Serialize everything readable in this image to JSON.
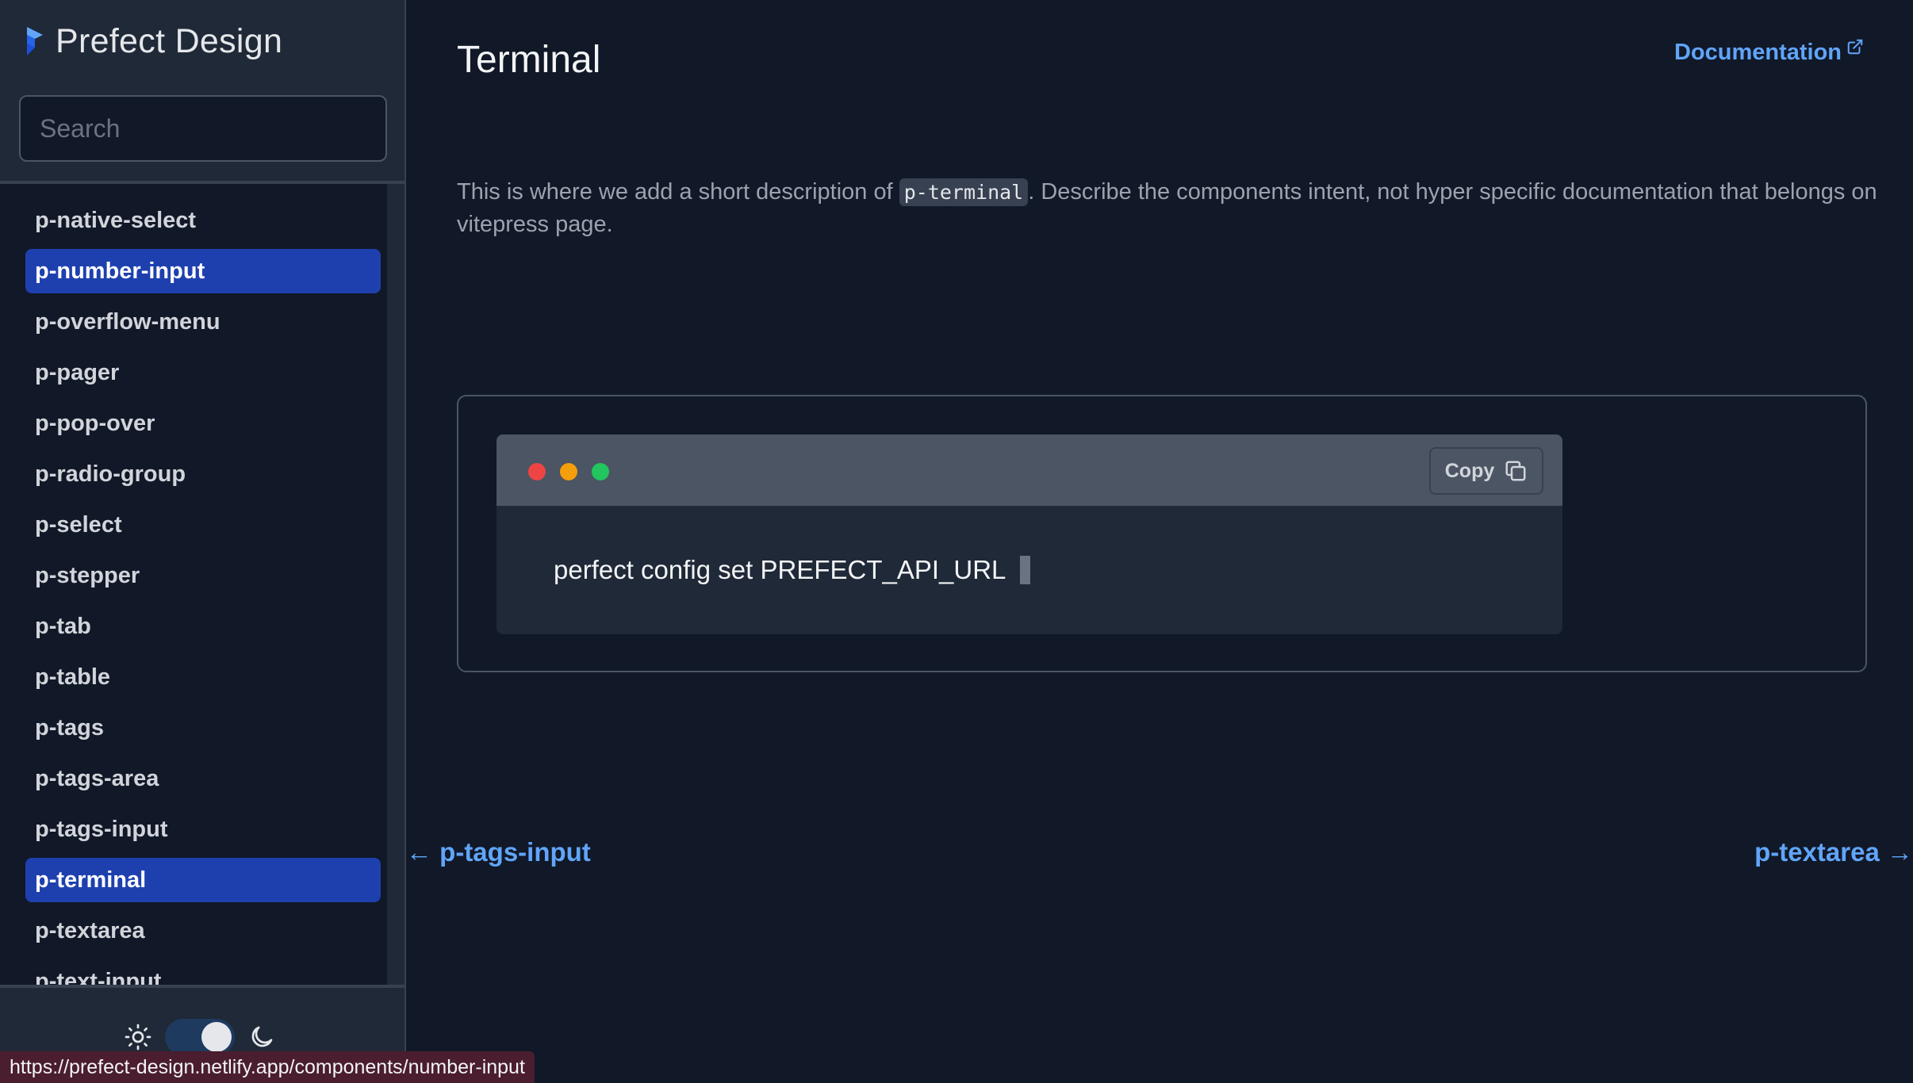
{
  "brand": {
    "title": "Prefect Design",
    "logo": "prefect-logo-icon"
  },
  "search": {
    "placeholder": "Search",
    "icon": "search-icon"
  },
  "sidebar": {
    "items": [
      {
        "label": "p-native-select",
        "active": false
      },
      {
        "label": "p-number-input",
        "active": true
      },
      {
        "label": "p-overflow-menu",
        "active": false
      },
      {
        "label": "p-pager",
        "active": false
      },
      {
        "label": "p-pop-over",
        "active": false
      },
      {
        "label": "p-radio-group",
        "active": false
      },
      {
        "label": "p-select",
        "active": false
      },
      {
        "label": "p-stepper",
        "active": false
      },
      {
        "label": "p-tab",
        "active": false
      },
      {
        "label": "p-table",
        "active": false
      },
      {
        "label": "p-tags",
        "active": false
      },
      {
        "label": "p-tags-area",
        "active": false
      },
      {
        "label": "p-tags-input",
        "active": false
      },
      {
        "label": "p-terminal",
        "active": true
      },
      {
        "label": "p-textarea",
        "active": false
      },
      {
        "label": "p-text-input",
        "active": false
      }
    ]
  },
  "theme": {
    "light_icon": "sun-icon",
    "dark_icon": "moon-icon",
    "dark_mode": true
  },
  "main": {
    "title": "Terminal",
    "doc_link": "Documentation",
    "description_before": "This is where we add a short description of ",
    "description_code": "p-terminal",
    "description_after": ". Describe the components intent, not hyper specific documentation that belongs on vitepress page.",
    "terminal": {
      "copy_label": "Copy",
      "command": "perfect config set PREFECT_API_URL"
    },
    "pager": {
      "prev": "← p-tags-input",
      "next": "p-textarea →"
    }
  },
  "status_url": "https://prefect-design.netlify.app/components/number-input",
  "colors": {
    "background": "#111827",
    "sidebar": "#1f2937",
    "accent": "#1e40af",
    "link": "#60a5fa"
  }
}
